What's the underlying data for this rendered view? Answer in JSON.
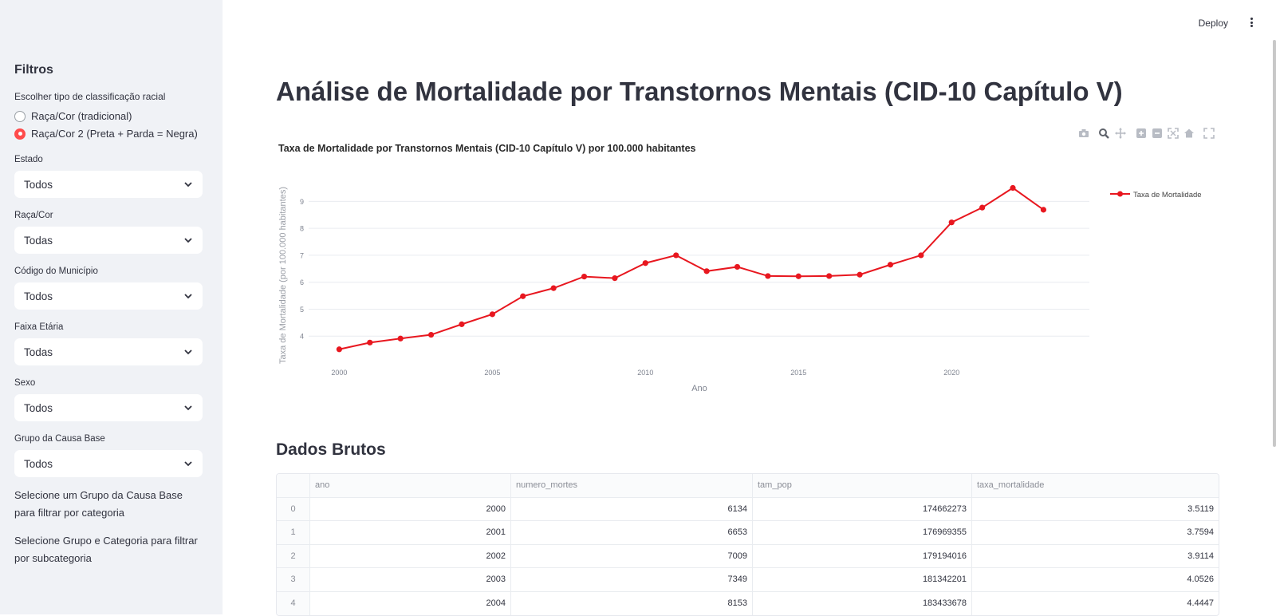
{
  "sidebar": {
    "title": "Filtros",
    "radio_label": "Escolher tipo de classificação racial",
    "radio_options": [
      "Raça/Cor (tradicional)",
      "Raça/Cor 2 (Preta + Parda = Negra)"
    ],
    "radio_selected": 1,
    "filters": [
      {
        "label": "Estado",
        "value": "Todos"
      },
      {
        "label": "Raça/Cor",
        "value": "Todas"
      },
      {
        "label": "Código do Município",
        "value": "Todos"
      },
      {
        "label": "Faixa Etária",
        "value": "Todas"
      },
      {
        "label": "Sexo",
        "value": "Todos"
      },
      {
        "label": "Grupo da Causa Base",
        "value": "Todos"
      }
    ],
    "note1": "Selecione um Grupo da Causa Base para filtrar por categoria",
    "note2": "Selecione Grupo e Categoria para filtrar por subcategoria"
  },
  "header": {
    "deploy_label": "Deploy"
  },
  "main": {
    "title": "Análise de Mortalidade por Transtornos Mentais (CID-10 Capítulo V)",
    "toolbar_icons": [
      "camera-icon",
      "zoom-icon",
      "pan-icon",
      "zoom-in-icon",
      "zoom-out-icon",
      "autoscale-icon",
      "reset-axes-icon",
      "fullscreen-icon"
    ],
    "section_title": "Dados Brutos",
    "table": {
      "columns": [
        "ano",
        "numero_mortes",
        "tam_pop",
        "taxa_mortalidade"
      ],
      "rows": [
        {
          "idx": "0",
          "ano": "2000",
          "numero_mortes": "6134",
          "tam_pop": "174662273",
          "taxa_mortalidade": "3.5119"
        },
        {
          "idx": "1",
          "ano": "2001",
          "numero_mortes": "6653",
          "tam_pop": "176969355",
          "taxa_mortalidade": "3.7594"
        },
        {
          "idx": "2",
          "ano": "2002",
          "numero_mortes": "7009",
          "tam_pop": "179194016",
          "taxa_mortalidade": "3.9114"
        },
        {
          "idx": "3",
          "ano": "2003",
          "numero_mortes": "7349",
          "tam_pop": "181342201",
          "taxa_mortalidade": "4.0526"
        },
        {
          "idx": "4",
          "ano": "2004",
          "numero_mortes": "8153",
          "tam_pop": "183433678",
          "taxa_mortalidade": "4.4447"
        }
      ]
    }
  },
  "colors": {
    "line": "#e8171f",
    "accent": "#ff4b4b",
    "sidebar_bg": "#f0f2f6"
  },
  "chart_data": {
    "type": "line",
    "title": "Taxa de Mortalidade por Transtornos Mentais (CID-10 Capítulo V) por 100.000 habitantes",
    "xlabel": "Ano",
    "ylabel": "Taxa de Mortalidade (por 100.000 habitantes)",
    "x_ticks": [
      2000,
      2005,
      2010,
      2015,
      2020
    ],
    "y_ticks": [
      4,
      5,
      6,
      7,
      8,
      9
    ],
    "xlim": [
      1999.0,
      2024.5
    ],
    "ylim": [
      3.0,
      9.9
    ],
    "grid": true,
    "legend": "top-right",
    "series": [
      {
        "name": "Taxa de Mortalidade",
        "x": [
          2000,
          2001,
          2002,
          2003,
          2004,
          2005,
          2006,
          2007,
          2008,
          2009,
          2010,
          2011,
          2012,
          2013,
          2014,
          2015,
          2016,
          2017,
          2018,
          2019,
          2020,
          2021,
          2022,
          2023
        ],
        "y": [
          3.51,
          3.76,
          3.91,
          4.05,
          4.44,
          4.81,
          5.48,
          5.78,
          6.21,
          6.15,
          6.71,
          7.0,
          6.41,
          6.57,
          6.23,
          6.22,
          6.23,
          6.28,
          6.65,
          7.0,
          8.22,
          8.77,
          9.5,
          8.69
        ]
      }
    ]
  }
}
